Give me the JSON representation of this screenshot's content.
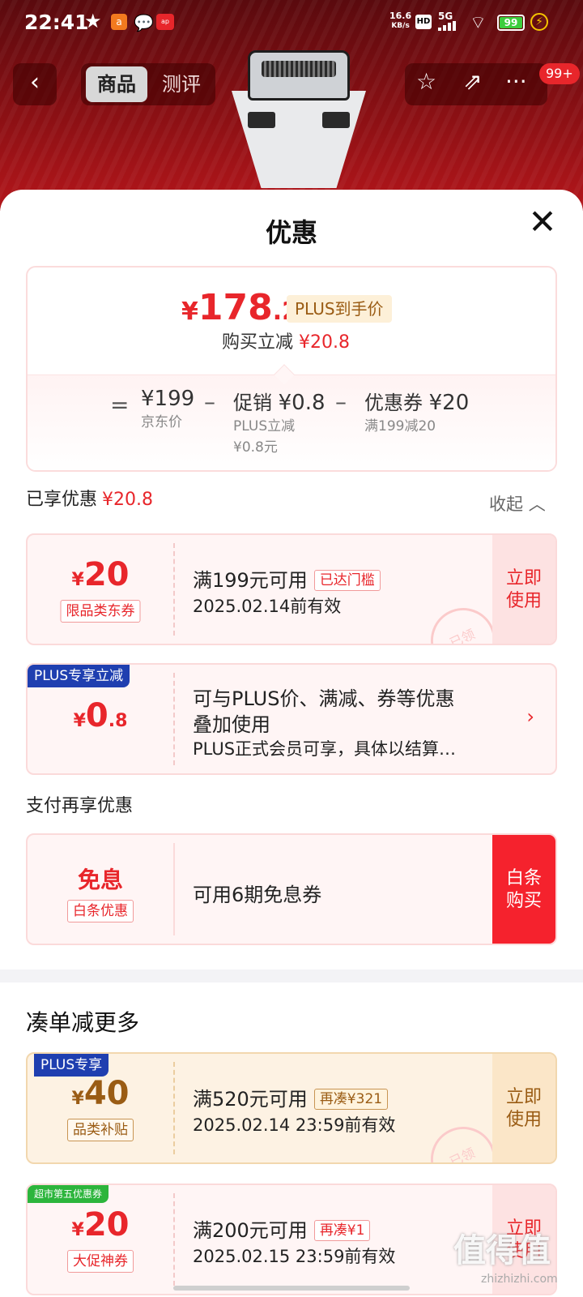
{
  "status_bar": {
    "time": "22:41",
    "net_speed": "16.6",
    "net_unit": "KB/s",
    "hd": "HD",
    "signal": "5G",
    "battery": "99"
  },
  "nav": {
    "back_icon": "chevron-left-icon",
    "tabs": [
      {
        "label": "商品",
        "active": true
      },
      {
        "label": "测评",
        "active": false
      }
    ],
    "badge": "99+"
  },
  "sheet": {
    "title": "优惠",
    "price": {
      "currency": "¥",
      "integer": "178",
      "decimal": ".2",
      "plus_tag": "PLUS到手价",
      "discount_label": "购买立减",
      "discount_value": "¥20.8"
    },
    "breakdown": {
      "eq": "=",
      "base_value": "¥199",
      "base_label": "京东价",
      "minus1": "–",
      "promo_label": "促销",
      "promo_value": "¥0.8",
      "promo_sub1": "PLUS立减",
      "promo_sub2": "¥0.8元",
      "minus2": "–",
      "coupon_label": "优惠券",
      "coupon_value": "¥20",
      "coupon_sub": "满199减20"
    },
    "enjoyed_label": "已享优惠",
    "enjoyed_value": "¥20.8",
    "collapse_label": "收起",
    "coupons": [
      {
        "currency": "¥",
        "amount": "20",
        "tag": "限品类东券",
        "title": "满199元可用",
        "badge": "已达门槛",
        "date": "2025.02.14前有效",
        "action": "立即使用",
        "stamp": "已领"
      },
      {
        "corner": "PLUS专享立减",
        "currency": "¥",
        "amount": "0",
        "decimal": ".8",
        "line1": "可与PLUS价、满减、券等优惠",
        "line2": "叠加使用",
        "line3": "PLUS正式会员可享，具体以结算…"
      }
    ],
    "pay_section_label": "支付再享优惠",
    "pay_card": {
      "title": "免息",
      "tag": "白条优惠",
      "text": "可用6期免息券",
      "action": "白条购买"
    },
    "more_label": "凑单减更多",
    "more_coupons": [
      {
        "corner": "PLUS专享",
        "currency": "¥",
        "amount": "40",
        "tag": "品类补贴",
        "title": "满520元可用",
        "badge": "再凑¥321",
        "date": "2025.02.14 23:59前有效",
        "action": "立即使用",
        "stamp": "已领"
      },
      {
        "corner": "超市第五优惠券",
        "currency": "¥",
        "amount": "20",
        "tag": "大促神券",
        "title": "满200元可用",
        "badge": "再凑¥1",
        "date": "2025.02.15 23:59前有效",
        "action": "立即使用"
      }
    ]
  },
  "watermark": {
    "main": "值得值",
    "sub": "zhizhizhi.com"
  },
  "colors": {
    "accent": "#e8262b",
    "plus_gold": "#9a5c14",
    "plus_blue": "#1f3fb0"
  }
}
